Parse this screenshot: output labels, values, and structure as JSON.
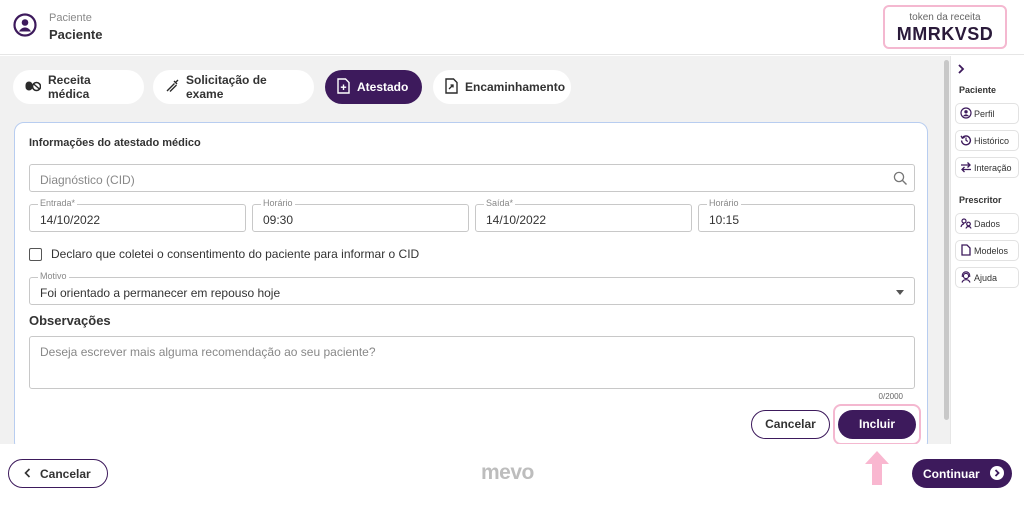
{
  "header": {
    "patient_small": "Paciente",
    "patient_name": "Paciente",
    "token_label": "token da receita",
    "token_value": "MMRKVSD",
    "avatar_icon": "user-circle-icon"
  },
  "tabs": [
    {
      "label": "Receita médica",
      "icon": "pills-icon",
      "active": false
    },
    {
      "label": "Solicitação de exame",
      "icon": "syringe-icon",
      "active": false
    },
    {
      "label": "Atestado",
      "icon": "document-plus-icon",
      "active": true
    },
    {
      "label": "Encaminhamento",
      "icon": "document-arrow-icon",
      "active": false
    }
  ],
  "form": {
    "title": "Informações do atestado médico",
    "diagnosis_placeholder": "Diagnóstico (CID)",
    "entrada_label": "Entrada*",
    "entrada_value": "14/10/2022",
    "horario1_label": "Horário",
    "horario1_value": "09:30",
    "saida_label": "Saída*",
    "saida_value": "14/10/2022",
    "horario2_label": "Horário",
    "horario2_value": "10:15",
    "consent_label": "Declaro que coletei o consentimento do paciente para informar o CID",
    "consent_checked": false,
    "motivo_label": "Motivo",
    "motivo_value": "Foi orientado a permanecer em repouso hoje",
    "observacoes_title": "Observações",
    "observacoes_placeholder": "Deseja escrever mais alguma recomendação ao seu paciente?",
    "counter": "0/2000",
    "cancel_label": "Cancelar",
    "include_label": "Incluir"
  },
  "sidebar": {
    "paciente_title": "Paciente",
    "paciente_items": [
      {
        "label": "Perfil",
        "icon": "user-circle-icon"
      },
      {
        "label": "Histórico",
        "icon": "history-icon"
      },
      {
        "label": "Interação",
        "icon": "swap-arrows-icon"
      }
    ],
    "prescritor_title": "Prescritor",
    "prescritor_items": [
      {
        "label": "Dados",
        "icon": "users-icon"
      },
      {
        "label": "Modelos",
        "icon": "document-icon"
      },
      {
        "label": "Ajuda",
        "icon": "support-icon"
      }
    ]
  },
  "footer": {
    "back_label": "Cancelar",
    "logo_text": "mevo",
    "continue_label": "Continuar"
  },
  "colors": {
    "primary": "#3d1a5c",
    "highlight": "#f4b8d0"
  }
}
